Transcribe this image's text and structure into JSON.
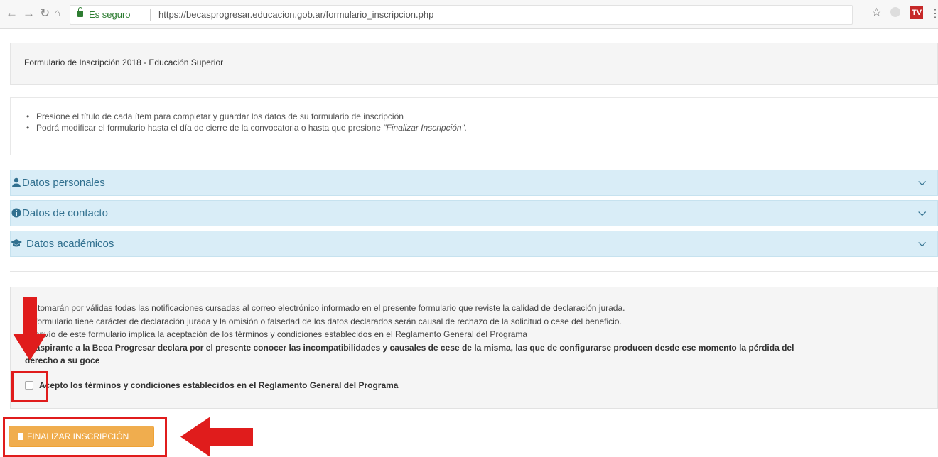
{
  "browser": {
    "secure_label": "Es seguro",
    "url": "https://becasprogresar.educacion.gob.ar/formulario_inscripcion.php",
    "ext_label": "TV"
  },
  "form": {
    "title": "Formulario de Inscripción 2018 - Educación Superior",
    "instructions": [
      "Presione el título de cada ítem para completar y guardar los datos de su formulario de inscripción",
      "Podrá modificar el formulario hasta el día de cierre de la convocatoria o hasta que presione "
    ],
    "instructions_em": "\"Finalizar Inscripción\".",
    "sections": [
      {
        "label": "Datos personales",
        "icon": "user-icon"
      },
      {
        "label": "Datos de contacto",
        "icon": "info-circle-icon"
      },
      {
        "label": "Datos académicos",
        "icon": "graduation-cap-icon"
      }
    ],
    "terms": {
      "line1": "Se tomarán por válidas todas las notificaciones cursadas al correo electrónico informado en el presente formulario que reviste la calidad de declaración jurada.",
      "line2": "El formulario tiene carácter de declaración jurada y la omisión o falsedad de los datos declarados serán causal de rechazo de la solicitud o cese del beneficio.",
      "line3": "El envío de este formulario implica la aceptación de los términos y condiciones establecidos en el Reglamento General del Programa",
      "line4a": "El aspirante a la ",
      "line4b": "Beca Progresar",
      "line4c": " declara por el presente conocer las incompatibilidades y causales de cese de la misma, las que de configurarse producen desde ese momento la pérdida del",
      "line5": "derecho a su goce",
      "checkbox_label": "Acepto los términos y condiciones establecidos en el Reglamento General del Programa",
      "checked": false
    },
    "finish_button": "FINALIZAR INSCRIPCIÓN"
  },
  "colors": {
    "accordion_bg": "#d9edf7",
    "accordion_text": "#31708f",
    "warning_button": "#f0ad4e",
    "annotation_red": "#e01c1c"
  }
}
